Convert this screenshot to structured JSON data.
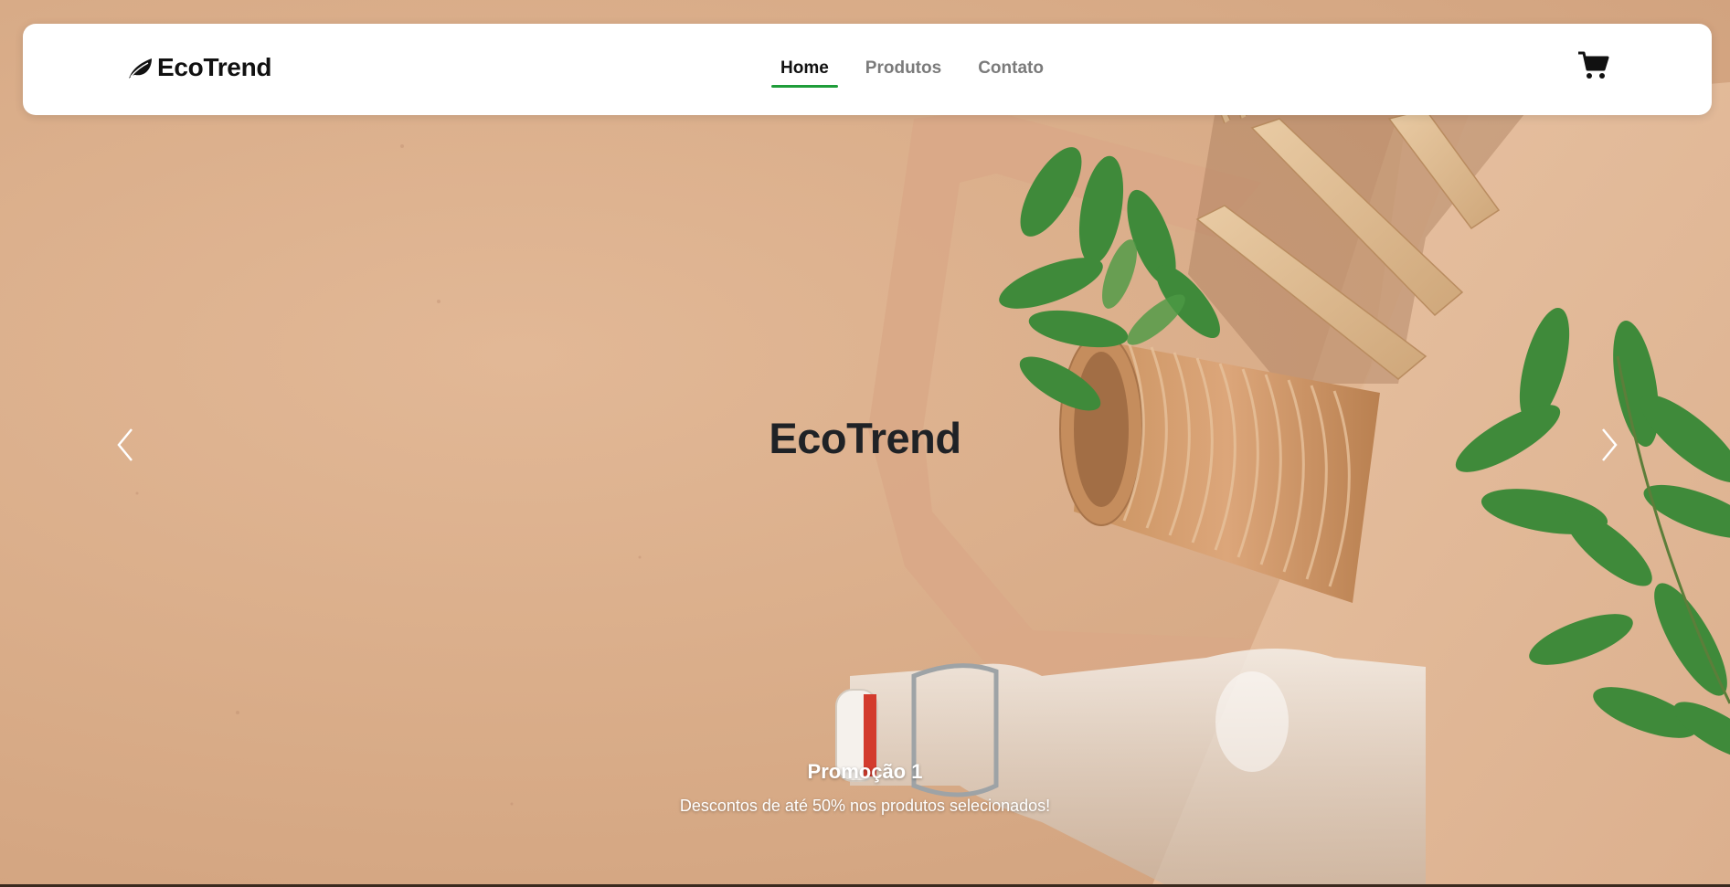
{
  "navbar": {
    "brand": "EcoTrend",
    "brand_icon": "leaf-icon",
    "links": [
      {
        "label": "Home",
        "active": true
      },
      {
        "label": "Produtos",
        "active": false
      },
      {
        "label": "Contato",
        "active": false
      }
    ],
    "cart_icon": "cart-icon"
  },
  "carousel": {
    "title": "EcoTrend",
    "prev_icon": "chevron-left-icon",
    "next_icon": "chevron-right-icon",
    "slide": {
      "title": "Promoção 1",
      "text": "Descontos de até 50% nos produtos selecionados!"
    }
  },
  "colors": {
    "accent": "#1f9d3a",
    "background": "#d9ac88",
    "navbar": "#ffffff",
    "text_dark": "#111111",
    "text_muted": "#7b7b7b"
  }
}
